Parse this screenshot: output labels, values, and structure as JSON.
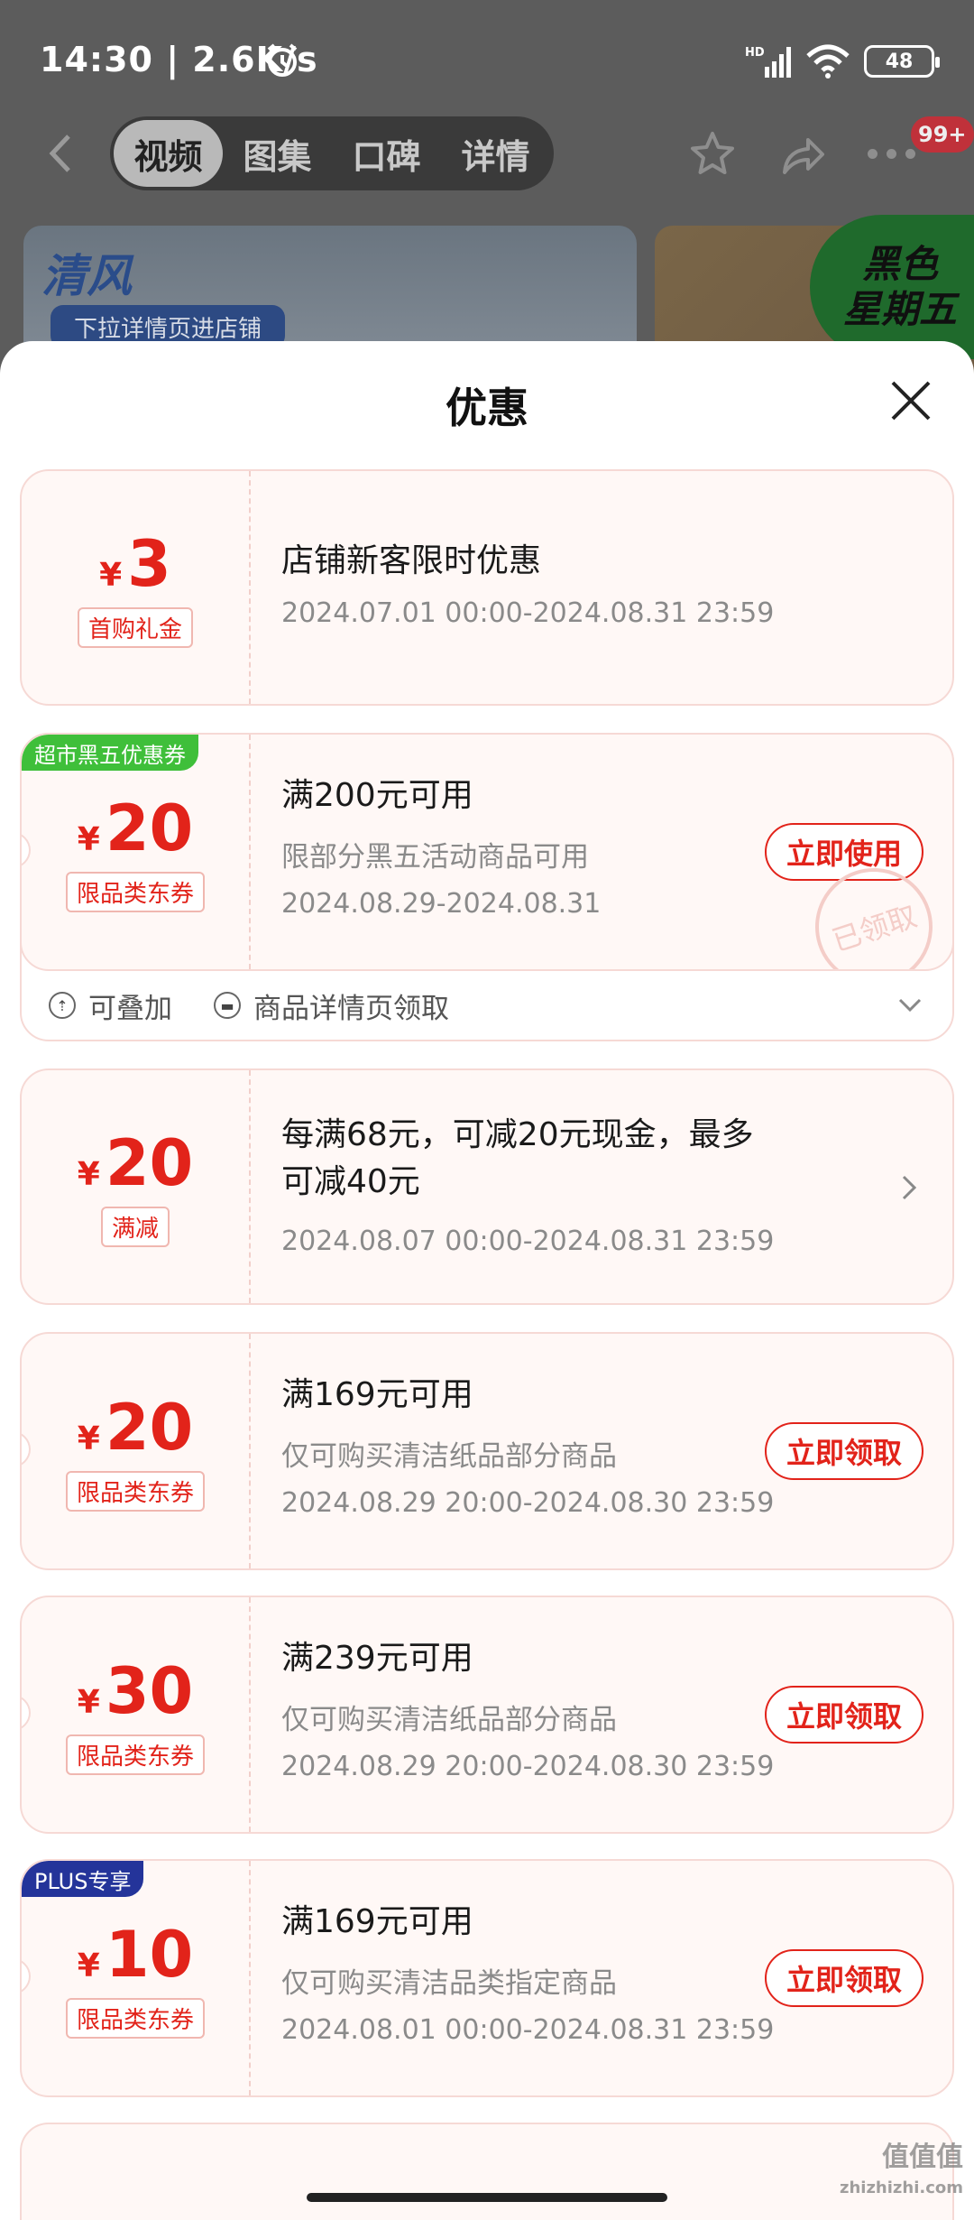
{
  "status_bar": {
    "time": "14:30 | 2.6K/s",
    "battery": "48",
    "network": "HD"
  },
  "top_nav": {
    "tabs": [
      {
        "label": "视频"
      },
      {
        "label": "图集"
      },
      {
        "label": "口碑"
      },
      {
        "label": "详情"
      }
    ],
    "badge": "99+"
  },
  "banner": {
    "brand": "清风",
    "tag": "下拉详情页进店铺",
    "promo": [
      "黑色",
      "星期五"
    ]
  },
  "sheet": {
    "title": "优惠"
  },
  "coupons": [
    {
      "currency": "¥",
      "amount": "3",
      "type": "首购礼金",
      "title": "店铺新客限时优惠",
      "date": "2024.07.01 00:00-2024.08.31 23:59"
    },
    {
      "corner_tag": "超市黑五优惠券",
      "currency": "¥",
      "amount": "20",
      "type": "限品类东券",
      "title": "满200元可用",
      "sub": "限部分黑五活动商品可用",
      "date": "2024.08.29-2024.08.31",
      "button": "立即使用",
      "stamp": "已领取",
      "extras": [
        {
          "icon": "stack-icon",
          "label": "可叠加"
        },
        {
          "icon": "ticket-icon",
          "label": "商品详情页领取"
        }
      ]
    },
    {
      "currency": "¥",
      "amount": "20",
      "type": "满减",
      "title_line1": "每满68元，可减20元现金，最多",
      "title_line2": "可减40元",
      "date": "2024.08.07 00:00-2024.08.31 23:59"
    },
    {
      "currency": "¥",
      "amount": "20",
      "type": "限品类东券",
      "title": "满169元可用",
      "sub": "仅可购买清洁纸品部分商品",
      "date": "2024.08.29 20:00-2024.08.30 23:59",
      "button": "立即领取"
    },
    {
      "currency": "¥",
      "amount": "30",
      "type": "限品类东券",
      "title": "满239元可用",
      "sub": "仅可购买清洁纸品部分商品",
      "date": "2024.08.29 20:00-2024.08.30 23:59",
      "button": "立即领取"
    },
    {
      "corner_tag": "PLUS专享",
      "currency": "¥",
      "amount": "10",
      "type": "限品类东券",
      "title": "满169元可用",
      "sub": "仅可购买清洁品类指定商品",
      "date": "2024.08.01 00:00-2024.08.31 23:59",
      "button": "立即领取"
    }
  ],
  "watermark": {
    "main": "值值值",
    "sub": "zhizhizhi.com"
  },
  "colors": {
    "accent": "#e2231a",
    "coupon_bg": "#fff8f6",
    "plus_blue": "#24349a",
    "black_friday_green": "#3fbf3a"
  }
}
